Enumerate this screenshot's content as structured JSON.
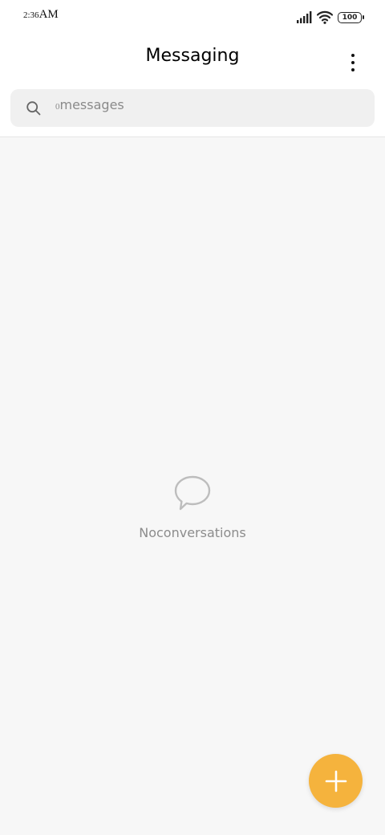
{
  "status_bar": {
    "time": "2:36",
    "ampm": "AM",
    "battery_level": "100",
    "icons": [
      "signal-icon",
      "wifi-icon",
      "battery-icon"
    ]
  },
  "header": {
    "title": "Messaging",
    "menu_icon": "more-vertical-icon"
  },
  "search": {
    "count": "0",
    "label": "messages",
    "icon": "search-icon"
  },
  "empty_state": {
    "icon": "chat-bubble-icon",
    "message": "Noconversations"
  },
  "fab": {
    "icon": "plus-icon",
    "color": "#f5b33d"
  },
  "colors": {
    "background": "#f7f7f7",
    "header_background": "#ffffff",
    "search_background": "#f0f0f0",
    "accent": "#f5b33d",
    "muted_text": "#8c8c8c"
  }
}
